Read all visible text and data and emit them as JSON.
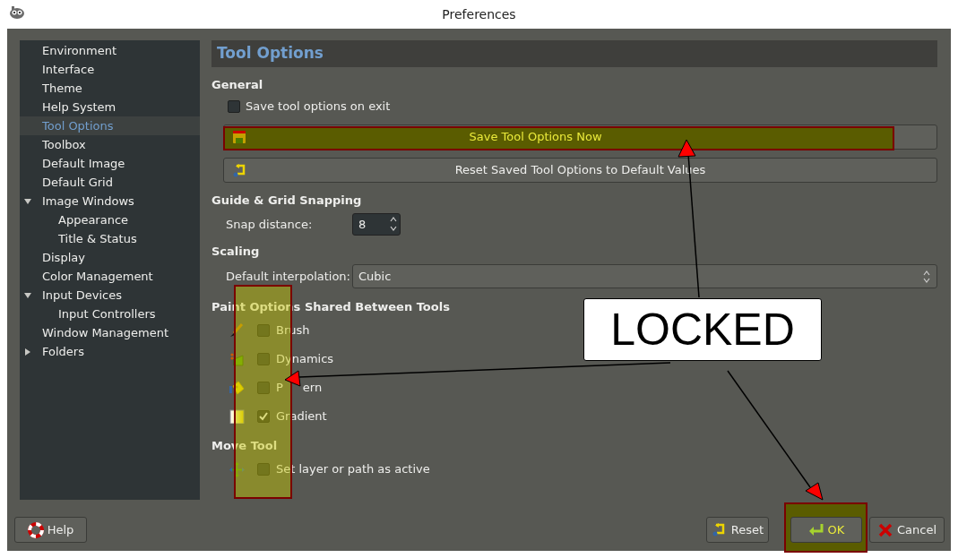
{
  "window": {
    "title": "Preferences"
  },
  "sidebar": {
    "items": [
      {
        "label": "Environment",
        "selected": false
      },
      {
        "label": "Interface",
        "selected": false
      },
      {
        "label": "Theme",
        "selected": false
      },
      {
        "label": "Help System",
        "selected": false
      },
      {
        "label": "Tool Options",
        "selected": true
      },
      {
        "label": "Toolbox",
        "selected": false
      },
      {
        "label": "Default Image",
        "selected": false
      },
      {
        "label": "Default Grid",
        "selected": false
      },
      {
        "label": "Image Windows",
        "selected": false,
        "expanded": true,
        "children": [
          {
            "label": "Appearance",
            "selected": false
          },
          {
            "label": "Title & Status",
            "selected": false
          }
        ]
      },
      {
        "label": "Display",
        "selected": false
      },
      {
        "label": "Color Management",
        "selected": false
      },
      {
        "label": "Input Devices",
        "selected": false,
        "expanded": true,
        "children": [
          {
            "label": "Input Controllers",
            "selected": false
          }
        ]
      },
      {
        "label": "Window Management",
        "selected": false
      },
      {
        "label": "Folders",
        "selected": false,
        "expanded": false
      }
    ]
  },
  "panel": {
    "title": "Tool Options",
    "general": {
      "heading": "General",
      "save_on_exit": {
        "label": "Save tool options on exit",
        "checked": false
      },
      "buttons": [
        "Save Tool Options Now",
        "Reset Saved Tool Options to Default Values"
      ]
    },
    "snapping": {
      "heading": "Guide & Grid Snapping",
      "label": "Snap distance:",
      "value": "8"
    },
    "scaling": {
      "heading": "Scaling",
      "label": "Default interpolation:",
      "value": "Cubic"
    },
    "paint_options": {
      "heading": "Paint Options Shared Between Tools",
      "items": [
        {
          "kind": "brush",
          "label": "Brush",
          "checked": false
        },
        {
          "kind": "dynamics",
          "label": "Dynamics",
          "checked": false
        },
        {
          "kind": "pattern",
          "label": "P",
          "label_after_arrow": "ern",
          "checked": false
        },
        {
          "kind": "gradient",
          "label": "Gradient",
          "checked": true
        }
      ]
    },
    "move_tool": {
      "heading": "Move Tool",
      "item": {
        "label": "Set layer or path as active",
        "checked": false
      }
    }
  },
  "footer": {
    "help": "Help",
    "reset": "Reset",
    "ok": "OK",
    "cancel": "Cancel"
  },
  "annotation": {
    "callout": "LOCKED"
  }
}
